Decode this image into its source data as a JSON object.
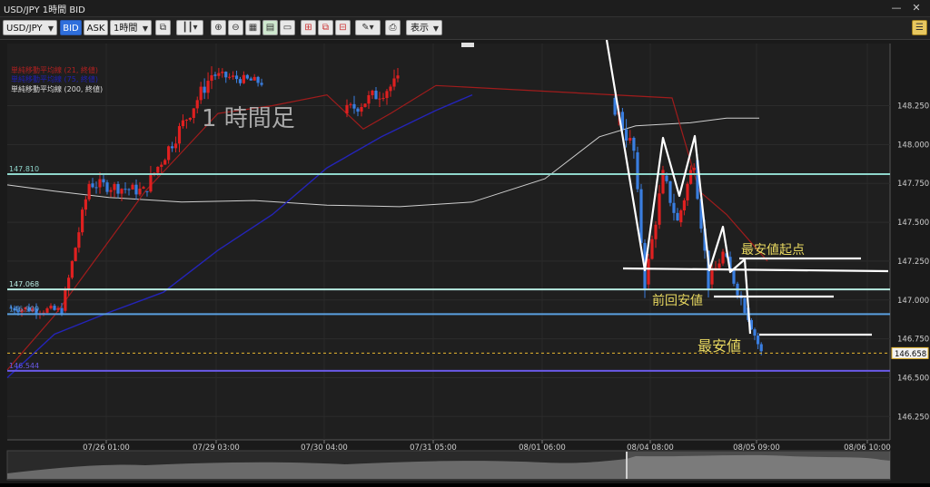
{
  "window": {
    "title": "USD/JPY 1時間 BID",
    "minimize": "—",
    "close": "✕"
  },
  "toolbar": {
    "symbol": "USD/JPY",
    "bid": "BID",
    "ask": "ASK",
    "timeframe": "1時間",
    "display_menu": "表示"
  },
  "legend": [
    {
      "text": "単純移動平均線 (21, 終値)",
      "color": "#b02020"
    },
    {
      "text": "単純移動平均線 (75, 終値)",
      "color": "#2020b0"
    },
    {
      "text": "単純移動平均線 (200, 終値)",
      "color": "#dddddd"
    }
  ],
  "annotations": {
    "timeframe_label": "1 時間足",
    "lowest_start": "最安値起点",
    "previous_low": "前回安値",
    "lowest": "最安値"
  },
  "chart_data": {
    "type": "candlestick",
    "ylim": [
      146.1,
      148.65
    ],
    "y_ticks": [
      "148.250",
      "148.000",
      "147.750",
      "147.500",
      "147.250",
      "147.000",
      "146.750",
      "146.500",
      "146.250"
    ],
    "x_ticks": [
      "07/26 01:00",
      "07/29 03:00",
      "07/30 04:00",
      "07/31 05:00",
      "08/01 06:00",
      "08/04 08:00",
      "08/05 09:00",
      "08/06 10:00"
    ],
    "horizontal_lines": [
      {
        "label": "147.810",
        "value": 147.81,
        "color": "#8fd6cc"
      },
      {
        "label": "147.068",
        "value": 147.068,
        "color": "#b8ece2"
      },
      {
        "label": "146.909",
        "value": 146.909,
        "color": "#5aa0e0"
      },
      {
        "label": "146.544",
        "value": 146.544,
        "color": "#6a5ae8"
      }
    ],
    "current_price": {
      "label": "146.658",
      "value": 146.658,
      "color": "#e8b830"
    },
    "up_color": "#e02020",
    "down_color": "#3a7ee0"
  }
}
